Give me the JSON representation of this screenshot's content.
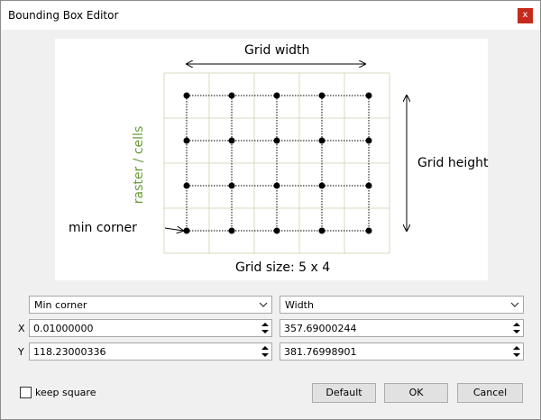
{
  "window": {
    "title": "Bounding Box Editor",
    "close_label": "x"
  },
  "diagram": {
    "grid_width_label": "Grid width",
    "grid_height_label": "Grid height",
    "raster_label": "raster / cells",
    "min_corner_label": "min corner",
    "grid_size_label": "Grid size: 5 x 4",
    "raster_color": "#6a9a3a",
    "cell_line_color": "#d8d8c0"
  },
  "form": {
    "left_combo": "Min corner",
    "right_combo": "Width",
    "x_label": "X",
    "y_label": "Y",
    "x_min": "0.01000000",
    "x_width": "357.69000244",
    "y_min": "118.23000336",
    "y_height": "381.76998901"
  },
  "footer": {
    "keep_square_label": "keep square",
    "keep_square_checked": false,
    "default_label": "Default",
    "ok_label": "OK",
    "cancel_label": "Cancel"
  }
}
